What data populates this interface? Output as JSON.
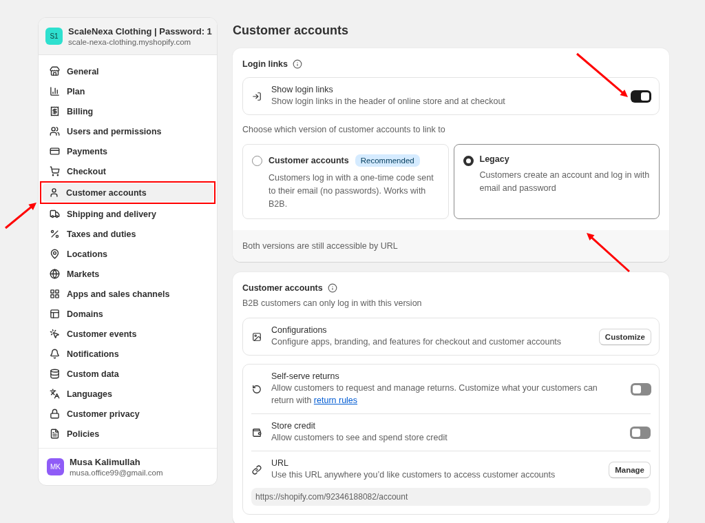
{
  "store": {
    "avatar": "S1",
    "name": "ScaleNexa Clothing | Password: 1",
    "domain": "scale-nexa-clothing.myshopify.com"
  },
  "nav": [
    {
      "label": "General",
      "selected": false,
      "outlined": false
    },
    {
      "label": "Plan",
      "selected": false,
      "outlined": false
    },
    {
      "label": "Billing",
      "selected": false,
      "outlined": false
    },
    {
      "label": "Users and permissions",
      "selected": false,
      "outlined": false
    },
    {
      "label": "Payments",
      "selected": false,
      "outlined": false
    },
    {
      "label": "Checkout",
      "selected": false,
      "outlined": false
    },
    {
      "label": "Customer accounts",
      "selected": true,
      "outlined": true
    },
    {
      "label": "Shipping and delivery",
      "selected": false,
      "outlined": false
    },
    {
      "label": "Taxes and duties",
      "selected": false,
      "outlined": false
    },
    {
      "label": "Locations",
      "selected": false,
      "outlined": false
    },
    {
      "label": "Markets",
      "selected": false,
      "outlined": false
    },
    {
      "label": "Apps and sales channels",
      "selected": false,
      "outlined": false
    },
    {
      "label": "Domains",
      "selected": false,
      "outlined": false
    },
    {
      "label": "Customer events",
      "selected": false,
      "outlined": false
    },
    {
      "label": "Notifications",
      "selected": false,
      "outlined": false
    },
    {
      "label": "Custom data",
      "selected": false,
      "outlined": false
    },
    {
      "label": "Languages",
      "selected": false,
      "outlined": false
    },
    {
      "label": "Customer privacy",
      "selected": false,
      "outlined": false
    },
    {
      "label": "Policies",
      "selected": false,
      "outlined": false
    }
  ],
  "user": {
    "avatar": "MK",
    "name": "Musa Kalimullah",
    "email": "musa.office99@gmail.com"
  },
  "page_title": "Customer accounts",
  "login_links": {
    "title": "Login links",
    "toggle_row": {
      "title": "Show login links",
      "description": "Show login links in the header of online store and at checkout",
      "on": true
    },
    "prompt": "Choose which version of customer accounts to link to",
    "options": [
      {
        "title": "Customer accounts",
        "badge": "Recommended",
        "description": "Customers log in with a one-time code sent to their email (no passwords). Works with B2B.",
        "selected": false
      },
      {
        "title": "Legacy",
        "description": "Customers create an account and log in with email and password",
        "selected": true
      }
    ],
    "footer": "Both versions are still accessible by URL"
  },
  "customer_accounts": {
    "title": "Customer accounts",
    "subtitle": "B2B customers can only log in with this version",
    "configurations": {
      "title": "Configurations",
      "description": "Configure apps, branding, and features for checkout and customer accounts",
      "button": "Customize"
    },
    "rows": [
      {
        "kind": "toggle",
        "title": "Self-serve returns",
        "description": "Allow customers to request and manage returns. Customize what your customers can return with ",
        "link": "return rules",
        "on": false
      },
      {
        "kind": "toggle",
        "title": "Store credit",
        "description": "Allow customers to see and spend store credit",
        "on": false
      },
      {
        "kind": "button",
        "title": "URL",
        "description": "Use this URL anywhere you’d like customers to access customer accounts",
        "button": "Manage",
        "value": "https://shopify.com/92346188082/account"
      }
    ]
  }
}
